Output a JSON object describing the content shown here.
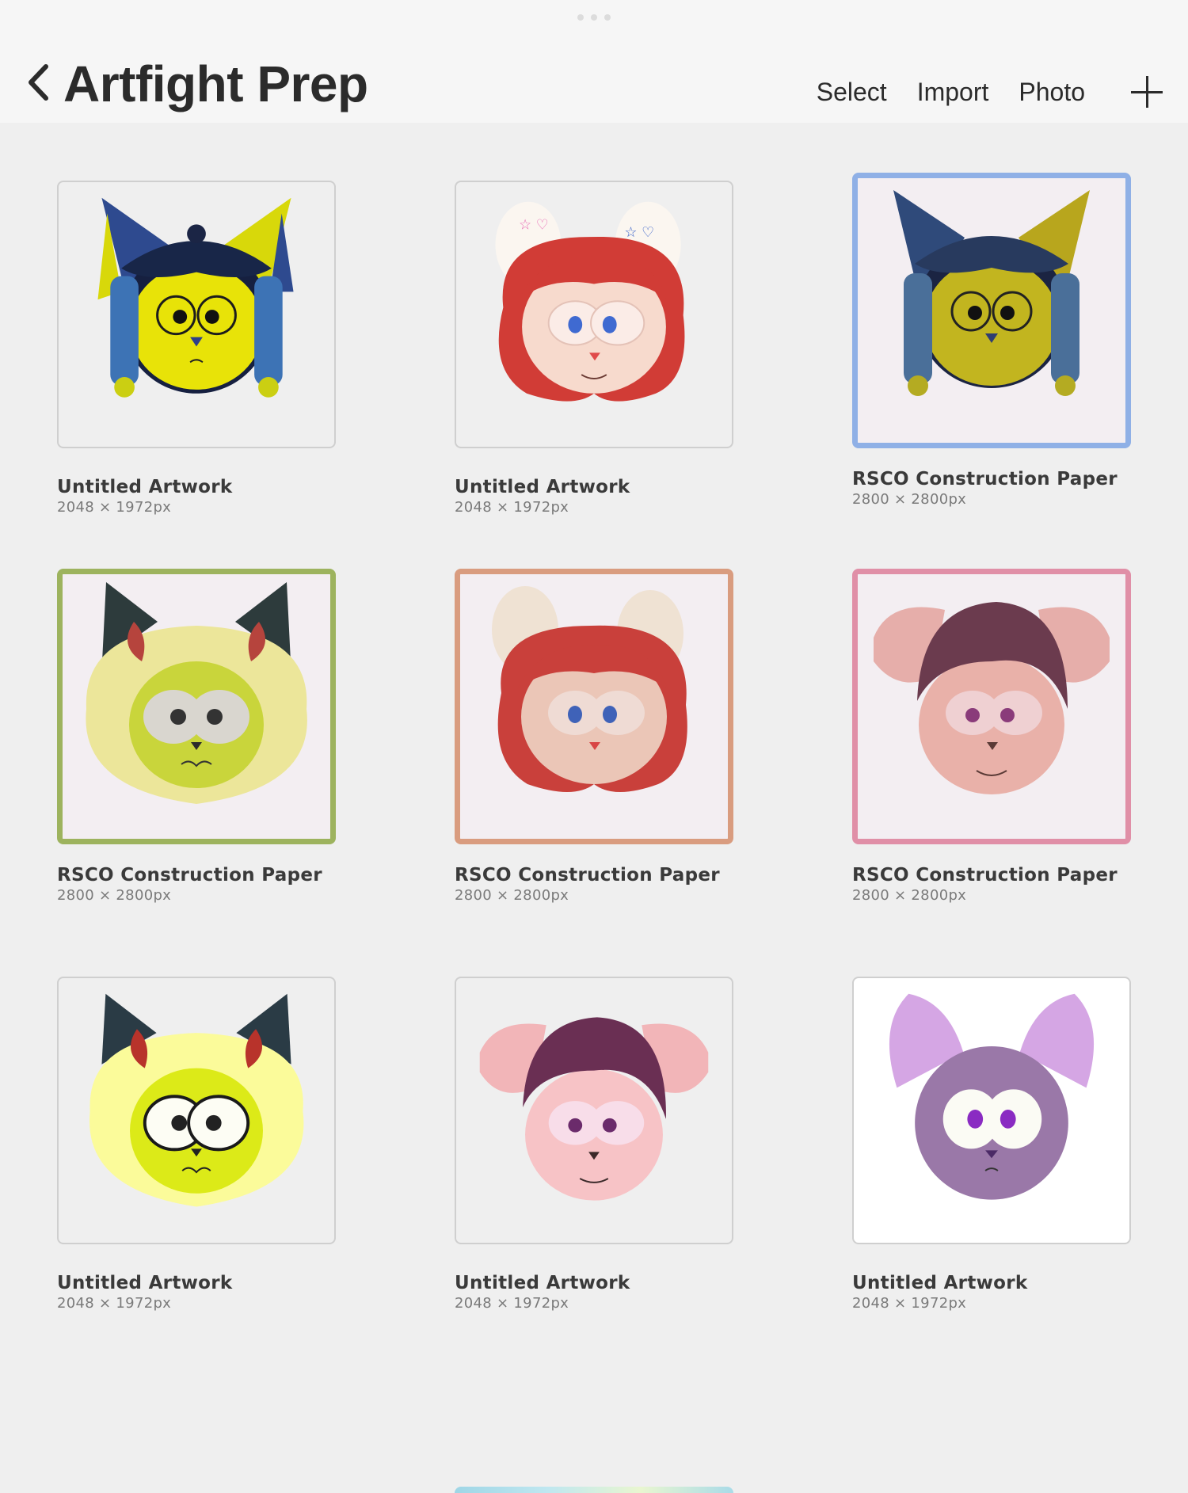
{
  "header": {
    "title": "Artfight Prep",
    "back_icon": "chevron-left-icon",
    "actions": [
      "Select",
      "Import",
      "Photo"
    ],
    "add_icon": "plus-icon"
  },
  "artworks": [
    {
      "name": "Untitled Artwork",
      "size": "2048 × 1972px"
    },
    {
      "name": "Untitled Artwork",
      "size": "2048 × 1972px"
    },
    {
      "name": "RSCO Construction Paper",
      "size": "2800 × 2800px",
      "border_color": "#8fb0e6"
    },
    {
      "name": "RSCO Construction Paper",
      "size": "2800 × 2800px",
      "border_color": "#9db35e"
    },
    {
      "name": "RSCO Construction Paper",
      "size": "2800 × 2800px",
      "border_color": "#d99c7f"
    },
    {
      "name": "RSCO Construction Paper",
      "size": "2800 × 2800px",
      "border_color": "#e08fa7"
    },
    {
      "name": "Untitled Artwork",
      "size": "2048 × 1972px"
    },
    {
      "name": "Untitled Artwork",
      "size": "2048 × 1972px"
    },
    {
      "name": "Untitled Artwork",
      "size": "2048 × 1972px"
    }
  ]
}
